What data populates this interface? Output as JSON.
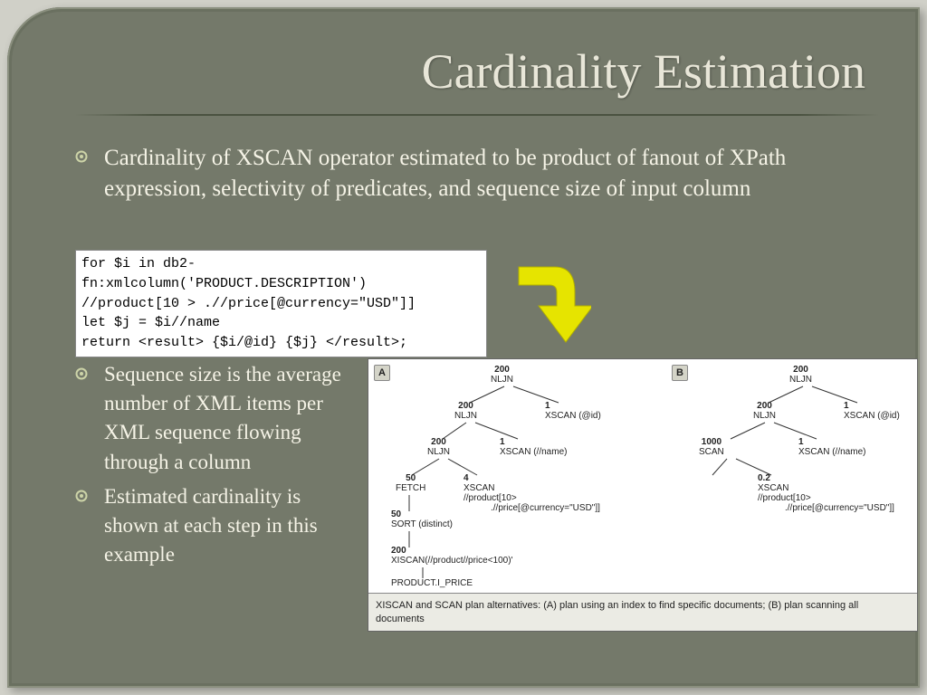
{
  "title": "Cardinality Estimation",
  "bullets": {
    "b1": "Cardinality of XSCAN operator estimated to be product of fanout of XPath expression, selectivity of predicates, and sequence size of input column",
    "b2": "Sequence size is the average number of XML items per XML sequence flowing through a column",
    "b3": "Estimated cardinality is shown at each step in this example"
  },
  "code": {
    "l1": "for $i in db2-fn:xmlcolumn('PRODUCT.DESCRIPTION')",
    "l2": "//product[10 > .//price[@currency=\"USD\"]]",
    "l3": "let $j = $i//name",
    "l4": "return <result> {$i/@id} {$j} </result>;"
  },
  "diagram": {
    "tagA": "A",
    "tagB": "B",
    "a": {
      "n1": {
        "num": "200",
        "lbl": "NLJN"
      },
      "n2": {
        "num": "200",
        "lbl": "NLJN"
      },
      "n3": {
        "num": "1",
        "lbl": "XSCAN (@id)"
      },
      "n4": {
        "num": "200",
        "lbl": "NLJN"
      },
      "n5": {
        "num": "1",
        "lbl": "XSCAN (//name)"
      },
      "n6": {
        "num": "50",
        "lbl": "FETCH"
      },
      "n7": {
        "num": "4",
        "lbl": "XSCAN",
        "extra1": "//product[10>",
        "extra2": ".//price[@currency=\"USD\"]]"
      },
      "n8": {
        "num": "50",
        "lbl": "SORT (distinct)"
      },
      "n9": {
        "num": "200",
        "lbl": "XISCAN(//product//price<100)'"
      },
      "n10": {
        "lbl": "PRODUCT.I_PRICE"
      }
    },
    "b": {
      "n1": {
        "num": "200",
        "lbl": "NLJN"
      },
      "n2": {
        "num": "200",
        "lbl": "NLJN"
      },
      "n3": {
        "num": "1",
        "lbl": "XSCAN (@id)"
      },
      "n4": {
        "num": "1000",
        "lbl": "SCAN"
      },
      "n5": {
        "num": "1",
        "lbl": "XSCAN (//name)"
      },
      "n6": {
        "num": "0.2",
        "lbl": "XSCAN",
        "extra1": "//product[10>",
        "extra2": ".//price[@currency=\"USD\"]]"
      }
    },
    "caption": "XISCAN and SCAN plan alternatives: (A) plan using an index to find specific documents; (B) plan scanning all documents"
  }
}
